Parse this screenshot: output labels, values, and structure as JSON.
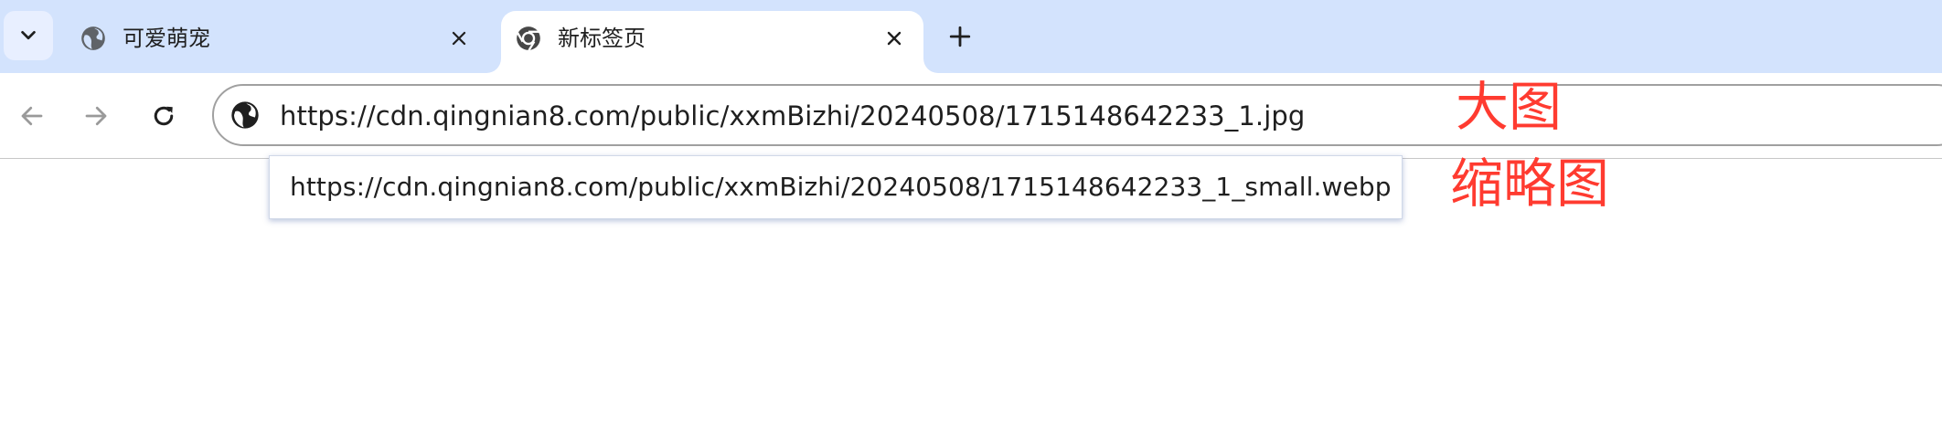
{
  "tabstrip": {
    "search_icon": "chevron-down-icon",
    "tabs": [
      {
        "title": "可爱萌宠",
        "favicon": "globe-icon",
        "active": false,
        "close_icon": "close-icon"
      },
      {
        "title": "新标签页",
        "favicon": "chrome-icon",
        "active": true,
        "close_icon": "close-icon"
      }
    ],
    "new_tab_icon": "plus-icon"
  },
  "toolbar": {
    "back_icon": "back-arrow-icon",
    "forward_icon": "forward-arrow-icon",
    "reload_icon": "reload-icon",
    "omnibox": {
      "site_icon": "globe-icon",
      "url": "https://cdn.qingnian8.com/public/xxmBizhi/20240508/1715148642233_1.jpg"
    }
  },
  "suggestion": {
    "url": "https://cdn.qingnian8.com/public/xxmBizhi/20240508/1715148642233_1_small.webp"
  },
  "annotations": {
    "large_image": "大图",
    "thumbnail": "缩略图",
    "color": "#ff3b30"
  },
  "colors": {
    "tabstrip_bg": "#d3e3fd",
    "active_tab_bg": "#ffffff",
    "icon": "#474747"
  }
}
